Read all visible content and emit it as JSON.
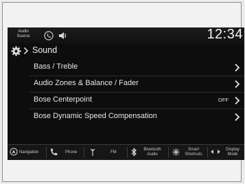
{
  "status_bar": {
    "audio_source_label": "Audio Source",
    "icons": [
      "phone-connected-icon",
      "speaker-icon"
    ],
    "clock": "12:34"
  },
  "breadcrumb": {
    "icon": "gear-icon",
    "title": "Sound"
  },
  "menu": {
    "items": [
      {
        "label": "Bass / Treble",
        "value": ""
      },
      {
        "label": "Audio Zones & Balance / Fader",
        "value": ""
      },
      {
        "label": "Bose Centerpoint",
        "value": "OFF"
      },
      {
        "label": "Bose Dynamic Speed Compensation",
        "value": ""
      }
    ]
  },
  "bottom_nav": {
    "items": [
      {
        "label": "Navigation",
        "icon": "navigation-icon"
      },
      {
        "label": "Phone",
        "icon": "phone-icon"
      },
      {
        "label": "FM",
        "icon": "antenna-icon"
      },
      {
        "label": "Bluetooth Audio",
        "icon": "bluetooth-icon"
      },
      {
        "label": "Smart Shortcuts",
        "icon": "shortcuts-icon"
      },
      {
        "label": "Display Mode",
        "icon": "display-mode-icon"
      }
    ]
  },
  "colors": {
    "screen_background": "#0d0d0d",
    "text": "#e8e8e8",
    "page_background": "#ececec"
  }
}
